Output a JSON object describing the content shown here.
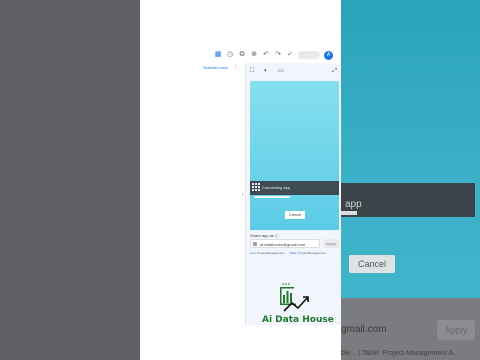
{
  "toolbar": {
    "icons": [
      "table-icon",
      "history-icon",
      "copy-icon",
      "zoom-icon",
      "undo-icon",
      "redo-icon",
      "check-icon"
    ],
    "avatar_initial": "A"
  },
  "left_panel": {
    "link_text": "Selected view",
    "more_glyph": "⋮"
  },
  "side_panel": {
    "tools": [
      "⛶",
      "◐",
      "▭"
    ],
    "close_glyph": "⤢",
    "collapse_glyph": "›",
    "preview": {
      "band_text": "Connecting app",
      "cancel_label": "Cancel",
      "progress": 0.4
    },
    "share_label": "Share app as ⓘ",
    "email_value": "ai.datahouse@gmail.com",
    "apply_label": "Apply",
    "chips": [
      {
        "prefix": "Live:",
        "text": "ProjectManagement..."
      },
      {
        "prefix": "Table:",
        "text": "ProjectManagement..."
      }
    ]
  },
  "background": {
    "band_text": "app",
    "cancel_label": "Cancel",
    "email_fragment": "gmail.com",
    "apply_label": "Apply",
    "bottom_text": "ble...   |   Table: Project Management A..."
  },
  "logo": {
    "name": "Ai Data House",
    "accent": "#1b7a2c"
  }
}
